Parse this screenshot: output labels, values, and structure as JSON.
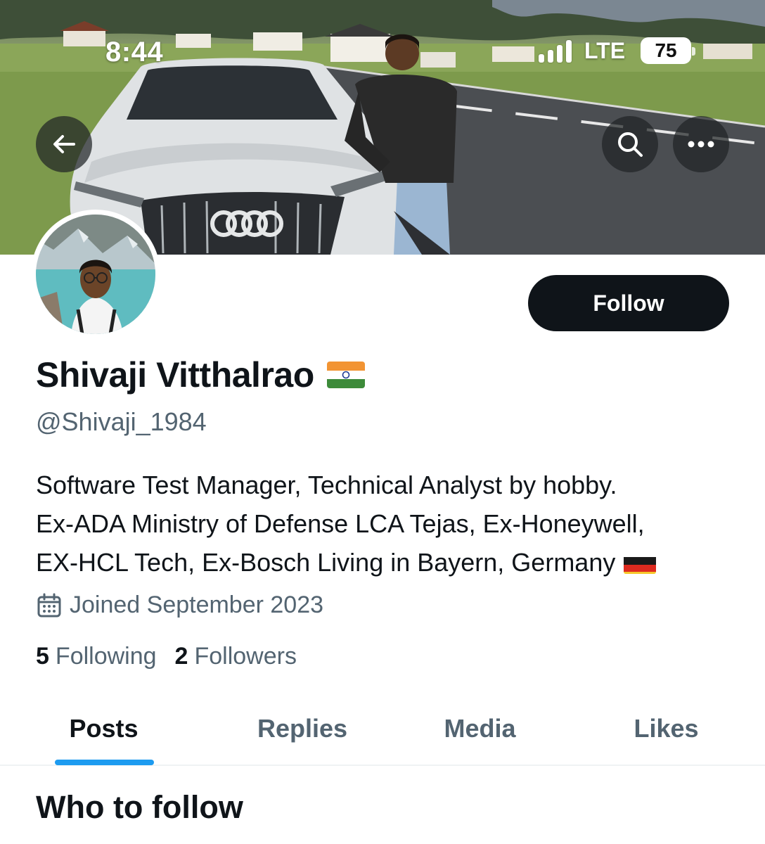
{
  "status_bar": {
    "time": "8:44",
    "network": "LTE",
    "battery": "75"
  },
  "header": {
    "back_icon": "arrow-left-icon",
    "search_icon": "search-icon",
    "more_icon": "more-horizontal-icon"
  },
  "profile": {
    "display_name": "Shivaji Vitthalrao",
    "name_emoji": "india-flag",
    "handle": "@Shivaji_1984",
    "follow_label": "Follow",
    "bio_lines": [
      "Software Test Manager, Technical Analyst by hobby.",
      "Ex-ADA Ministry of Defense LCA Tejas, Ex-Honeywell,",
      "EX-HCL Tech, Ex-Bosch Living in Bayern, Germany"
    ],
    "bio_emoji": "germany-flag",
    "joined": "Joined September 2023",
    "joined_icon": "calendar-icon",
    "following_count": "5",
    "following_label": "Following",
    "followers_count": "2",
    "followers_label": "Followers"
  },
  "tabs": [
    {
      "label": "Posts",
      "active": true
    },
    {
      "label": "Replies",
      "active": false
    },
    {
      "label": "Media",
      "active": false
    },
    {
      "label": "Likes",
      "active": false
    }
  ],
  "section": {
    "title": "Who to follow"
  },
  "colors": {
    "accent": "#1d9bf0",
    "text_primary": "#0f1419",
    "text_secondary": "#536471",
    "button_dark": "#0f1419"
  }
}
